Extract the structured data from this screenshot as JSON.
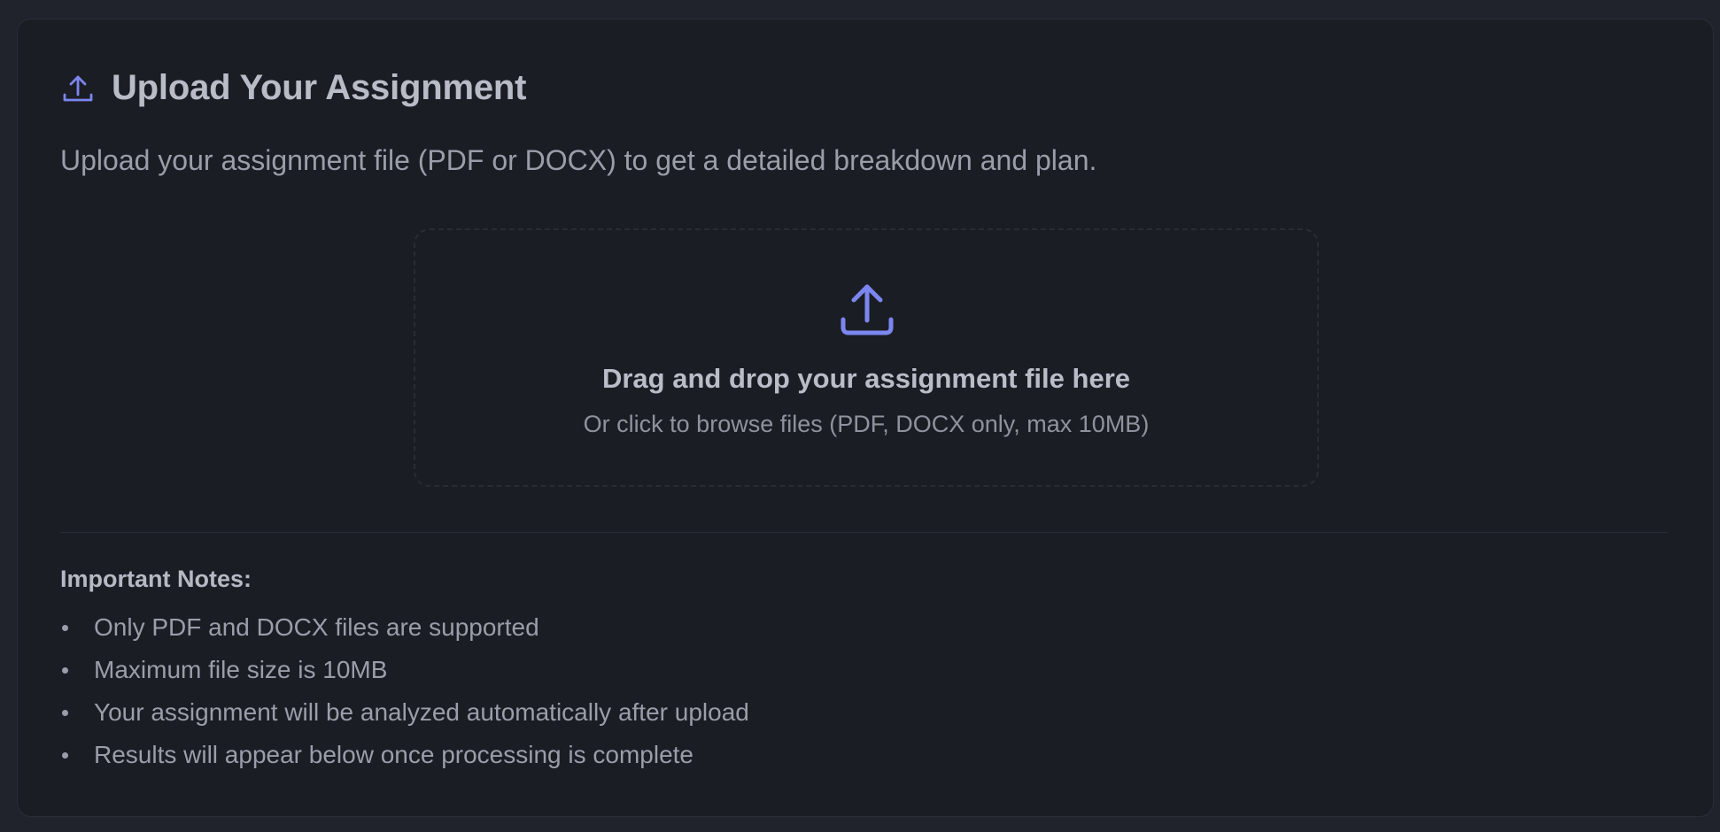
{
  "header": {
    "icon": "upload-icon",
    "title": "Upload Your Assignment"
  },
  "description": "Upload your assignment file (PDF or DOCX) to get a detailed breakdown and plan.",
  "dropzone": {
    "icon": "upload-icon",
    "title": "Drag and drop your assignment file here",
    "subtitle": "Or click to browse files (PDF, DOCX only, max 10MB)"
  },
  "notes": {
    "title": "Important Notes:",
    "items": [
      "Only PDF and DOCX files are supported",
      "Maximum file size is 10MB",
      "Your assignment will be analyzed automatically after upload",
      "Results will appear below once processing is complete"
    ]
  },
  "colors": {
    "accent": "#7b86f0",
    "background": "#20232b",
    "card": "#1b1d24"
  }
}
